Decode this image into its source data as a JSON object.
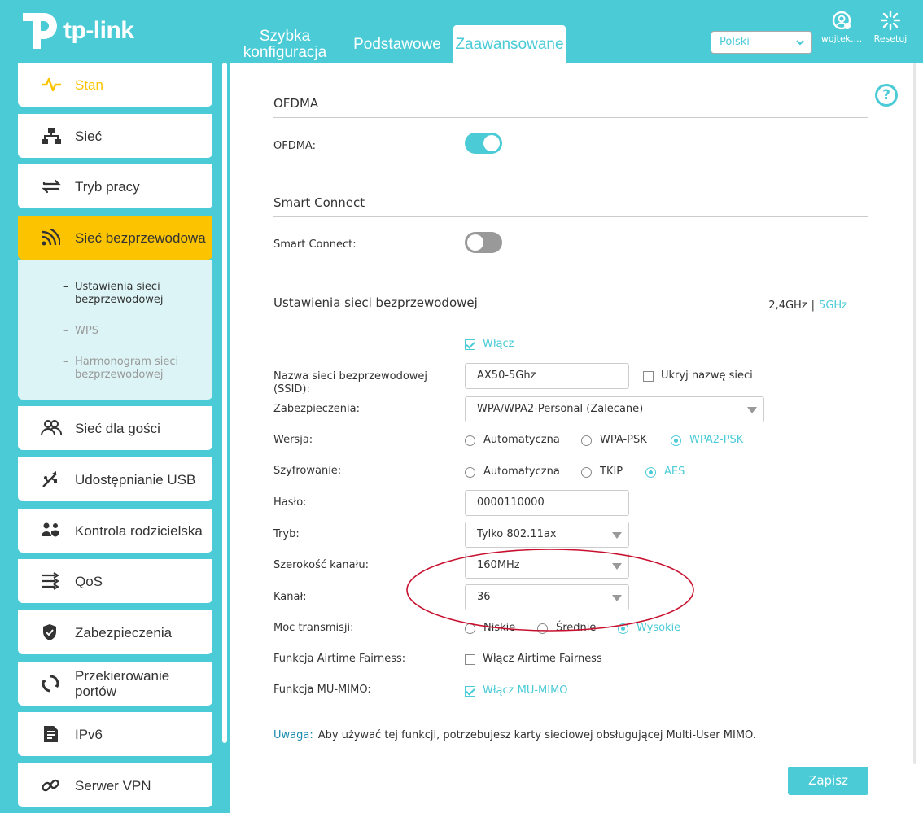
{
  "brand": {
    "name": "tp-link",
    "accent": "#4acbd6",
    "highlight": "#fcc400"
  },
  "header": {
    "tabs": [
      {
        "label_line1": "Szybka",
        "label_line2": "konfiguracja"
      },
      {
        "label": "Podstawowe"
      },
      {
        "label": "Zaawansowane",
        "active": true
      }
    ],
    "language": {
      "value": "Polski"
    },
    "user": {
      "label": "wojtek....",
      "icon": "user-icon"
    },
    "reset": {
      "label": "Resetuj",
      "icon": "reset-icon"
    }
  },
  "sidebar": {
    "items": [
      {
        "label": "Stan",
        "icon": "pulse-icon"
      },
      {
        "label": "Sieć",
        "icon": "network-icon"
      },
      {
        "label": "Tryb pracy",
        "icon": "mode-icon"
      },
      {
        "label": "Sieć bezprzewodowa",
        "icon": "wireless-icon",
        "active": true
      },
      {
        "label": "Sieć dla gości",
        "icon": "guests-icon"
      },
      {
        "label": "Udostępnianie USB",
        "icon": "usb-icon"
      },
      {
        "label": "Kontrola rodzicielska",
        "icon": "parental-icon"
      },
      {
        "label": "QoS",
        "icon": "qos-icon"
      },
      {
        "label": "Zabezpieczenia",
        "icon": "shield-icon"
      },
      {
        "label_line1": "Przekierowanie",
        "label_line2": "portów",
        "icon": "forwarding-icon"
      },
      {
        "label": "IPv6",
        "icon": "ipv6-icon"
      },
      {
        "label": "Serwer VPN",
        "icon": "vpn-icon"
      }
    ],
    "subitems": [
      {
        "line1": "Ustawienia sieci",
        "line2": "bezprzewodowej",
        "current": true
      },
      {
        "line1": "WPS"
      },
      {
        "line1": "Harmonogram sieci",
        "line2": "bezprzewodowej"
      }
    ],
    "dash": "–"
  },
  "main": {
    "ofdma": {
      "title": "OFDMA",
      "label": "OFDMA:",
      "enabled": true
    },
    "smart_connect": {
      "title": "Smart Connect",
      "label": "Smart Connect:",
      "enabled": false
    },
    "wireless": {
      "title": "Ustawienia sieci bezprzewodowej",
      "band_24": "2,4GHz",
      "band_sep": "|",
      "band_5": "5GHz",
      "enable_label": "Włącz",
      "ssid_label_line1": "Nazwa sieci bezprzewodowej",
      "ssid_label_line2": "(SSID):",
      "ssid_value": "AX50-5Ghz",
      "hide_ssid_label": "Ukryj nazwę sieci",
      "security_label": "Zabezpieczenia:",
      "security_value": "WPA/WPA2-Personal (Zalecane)",
      "version_label": "Wersja:",
      "version_options": [
        "Automatyczna",
        "WPA-PSK",
        "WPA2-PSK"
      ],
      "version_selected": "WPA2-PSK",
      "encryption_label": "Szyfrowanie:",
      "encryption_options": [
        "Automatyczna",
        "TKIP",
        "AES"
      ],
      "encryption_selected": "AES",
      "password_label": "Hasło:",
      "password_value": "0000110000",
      "mode_label": "Tryb:",
      "mode_value": "Tylko 802.11ax",
      "width_label": "Szerokość kanału:",
      "width_value": "160MHz",
      "channel_label": "Kanał:",
      "channel_value": "36",
      "power_label": "Moc transmisji:",
      "power_options": [
        "Niskie",
        "Średnie",
        "Wysokie"
      ],
      "power_selected": "Wysokie",
      "airtime_label": "Funkcja Airtime Fairness:",
      "airtime_check": "Włącz Airtime Fairness",
      "mumimo_label": "Funkcja MU-MIMO:",
      "mumimo_check": "Włącz MU-MIMO"
    },
    "note": {
      "key": "Uwaga:",
      "text": "Aby używać tej funkcji, potrzebujesz karty sieciowej obsługującej Multi-User MIMO."
    },
    "save_label": "Zapisz",
    "help_icon": "?"
  }
}
